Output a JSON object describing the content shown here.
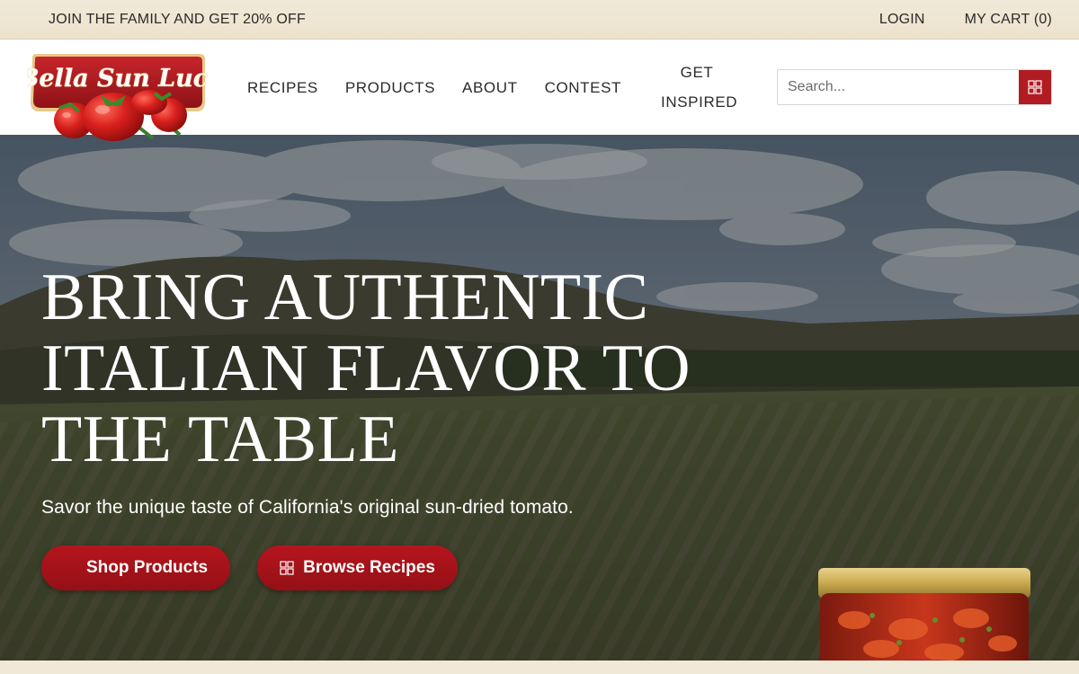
{
  "topbar": {
    "promo": "JOIN THE FAMILY AND GET 20% OFF",
    "login": "LOGIN",
    "cart": "MY CART (0)"
  },
  "brand": {
    "logo_text": "Bella Sun Luci",
    "colors": {
      "primary_red": "#b01c22",
      "cream": "#f1e9d8"
    }
  },
  "nav": {
    "items": [
      {
        "label": "RECIPES"
      },
      {
        "label": "PRODUCTS"
      },
      {
        "label": "ABOUT"
      },
      {
        "label": "CONTEST"
      }
    ],
    "inspired_line1": "GET",
    "inspired_line2": "INSPIRED"
  },
  "search": {
    "placeholder": "Search...",
    "button_icon": "grid-icon"
  },
  "hero": {
    "title_line1": "BRING AUTHENTIC",
    "title_line2": "ITALIAN FLAVOR TO",
    "title_line3": "THE TABLE",
    "subtitle": "Savor the unique taste of California's original sun-dried tomato.",
    "shop_button": "Shop Products",
    "browse_button": "Browse Recipes",
    "browse_icon": "grid-icon",
    "background": "vineyard-landscape-image",
    "product_image": "sun-dried-tomato-jar"
  }
}
